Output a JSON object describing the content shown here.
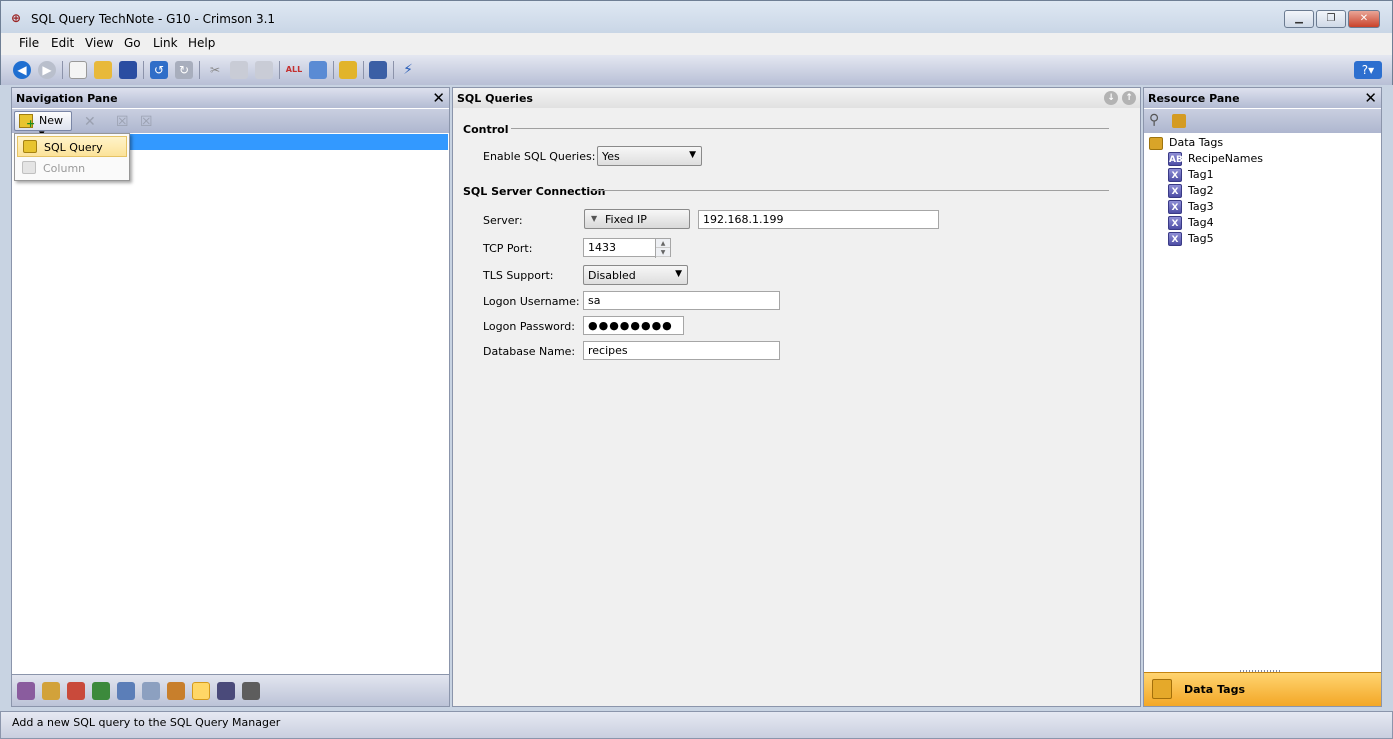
{
  "window": {
    "title": "SQL Query TechNote - G10 - Crimson 3.1"
  },
  "menu": [
    "File",
    "Edit",
    "View",
    "Go",
    "Link",
    "Help"
  ],
  "navigation_pane": {
    "title": "Navigation Pane",
    "new_button": "New",
    "dropdown": {
      "items": [
        {
          "label": "SQL Query",
          "enabled": true
        },
        {
          "label": "Column",
          "enabled": false
        }
      ]
    }
  },
  "sql_pane": {
    "title": "SQL Queries",
    "control": {
      "heading": "Control",
      "enable_label": "Enable SQL Queries:",
      "enable_value": "Yes"
    },
    "connection": {
      "heading": "SQL Server Connection",
      "server_label": "Server:",
      "server_mode": "Fixed IP",
      "server_ip": "192.168.1.199",
      "port_label": "TCP Port:",
      "port_value": "1433",
      "tls_label": "TLS Support:",
      "tls_value": "Disabled",
      "username_label": "Logon Username:",
      "username_value": "sa",
      "password_label": "Logon Password:",
      "password_value": "●●●●●●●●",
      "database_label": "Database Name:",
      "database_value": "recipes"
    }
  },
  "resource_pane": {
    "title": "Resource Pane",
    "root": "Data Tags",
    "tags": [
      {
        "label": "RecipeNames",
        "icon": "AB"
      },
      {
        "label": "Tag1",
        "icon": "X"
      },
      {
        "label": "Tag2",
        "icon": "X"
      },
      {
        "label": "Tag3",
        "icon": "X"
      },
      {
        "label": "Tag4",
        "icon": "X"
      },
      {
        "label": "Tag5",
        "icon": "X"
      }
    ],
    "bottom_label": "Data Tags"
  },
  "status": "Add a new SQL query to the SQL Query Manager",
  "colors": {
    "selection": "#3399ff",
    "accent_bar": "#f3a726",
    "pane_header": "#b3bbd3"
  }
}
